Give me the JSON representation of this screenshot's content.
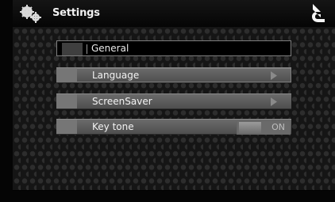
{
  "header": {
    "title": "Settings",
    "left_icon": "gears-icon",
    "right_icon": "back-arrow-icon"
  },
  "rows": [
    {
      "label": "General",
      "icon": "gear-icon"
    },
    {
      "label": "Language",
      "icon": "chevron-right-icon"
    },
    {
      "label": "ScreenSaver",
      "icon": "chevron-right-icon"
    },
    {
      "label": "Key tone",
      "control": "toggle",
      "state": "ON"
    }
  ],
  "colors": {
    "background": "#151515",
    "row": "#5e5e5e",
    "text": "#f1f1f1"
  }
}
